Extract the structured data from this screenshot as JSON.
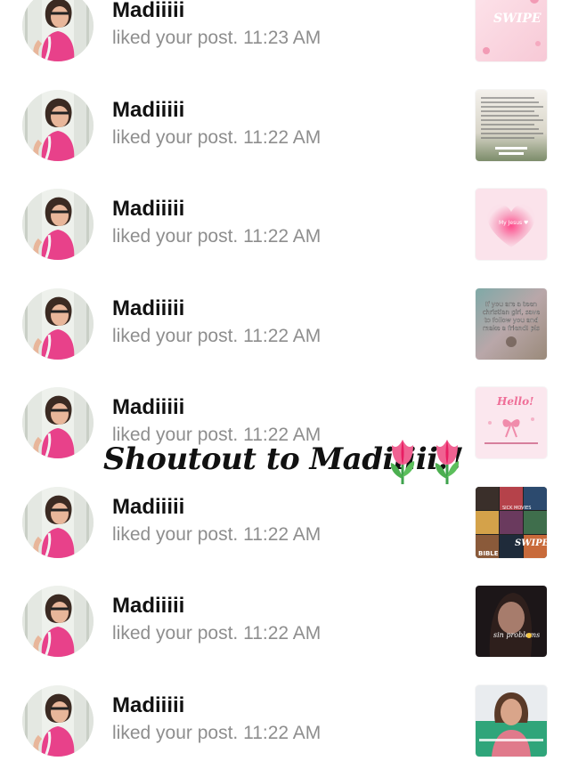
{
  "notifications": [
    {
      "user": "Madiiiii",
      "action": "liked your post.",
      "time": "11:23 AM",
      "thumb": "swipe-pink"
    },
    {
      "user": "Madiiiii",
      "action": "liked your post.",
      "time": "11:22 AM",
      "thumb": "text-note"
    },
    {
      "user": "Madiiiii",
      "action": "liked your post.",
      "time": "11:22 AM",
      "thumb": "pink-heart"
    },
    {
      "user": "Madiiiii",
      "action": "liked your post.",
      "time": "11:22 AM",
      "thumb": "christian-girl"
    },
    {
      "user": "Madiiiii",
      "action": "liked your post.",
      "time": "11:22 AM",
      "thumb": "hello-bow"
    },
    {
      "user": "Madiiiii",
      "action": "liked your post.",
      "time": "11:22 AM",
      "thumb": "movie-grid"
    },
    {
      "user": "Madiiiii",
      "action": "liked your post.",
      "time": "11:22 AM",
      "thumb": "dark-selfie"
    },
    {
      "user": "Madiiiii",
      "action": "liked your post.",
      "time": "11:22 AM",
      "thumb": "girl-photo"
    }
  ],
  "thumb_text": {
    "swipe": "SWIPE",
    "hearts_text": "My Jesus ♥",
    "christian": [
      "If you are a teen",
      "christian girl, save",
      "to follow you and",
      "make a friend! pls"
    ],
    "hello": "Hello!",
    "swipe2": "SWIPE",
    "bible": "BIBLE",
    "sick": "SICK MOVIES",
    "problems": "sin problems"
  },
  "overlay": {
    "text": "Shoutout to Madiiiii!!",
    "emoji": "tulip"
  },
  "colors": {
    "name": "#111111",
    "meta": "#8e8e8e",
    "pink": "#ef4f86",
    "bg": "#ffffff"
  }
}
